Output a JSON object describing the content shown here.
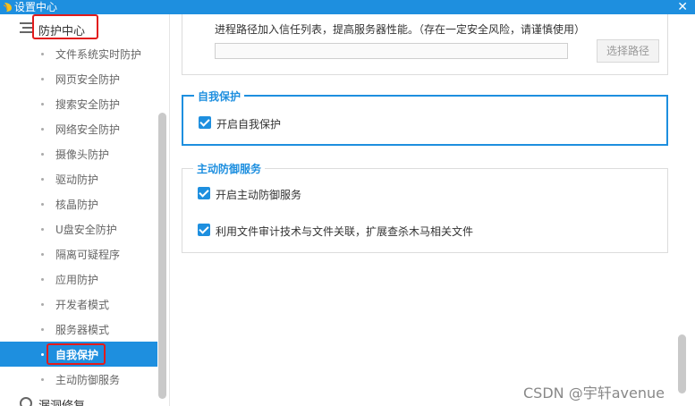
{
  "window": {
    "title": "设置中心",
    "close_symbol": "✕"
  },
  "sidebar": {
    "group_label": "防护中心",
    "items": [
      {
        "label": "文件系统实时防护"
      },
      {
        "label": "网页安全防护"
      },
      {
        "label": "搜索安全防护"
      },
      {
        "label": "网络安全防护"
      },
      {
        "label": "摄像头防护"
      },
      {
        "label": "驱动防护"
      },
      {
        "label": "核晶防护"
      },
      {
        "label": "U盘安全防护"
      },
      {
        "label": "隔离可疑程序"
      },
      {
        "label": "应用防护"
      },
      {
        "label": "开发者模式"
      },
      {
        "label": "服务器模式"
      },
      {
        "label": "自我保护"
      },
      {
        "label": "主动防御服务"
      }
    ],
    "active_index": 12,
    "bottom_group_label": "漏洞修复"
  },
  "main": {
    "trust_description": "进程路径加入信任列表，提高服务器性能。（存在一定安全风险，请谨慎使用）",
    "path_value": "",
    "select_path_button": "选择路径",
    "self_protect": {
      "title": "自我保护",
      "options": [
        {
          "label": "开启自我保护",
          "checked": true
        }
      ]
    },
    "active_defense": {
      "title": "主动防御服务",
      "options": [
        {
          "label": "开启主动防御服务",
          "checked": true
        },
        {
          "label": "利用文件审计技术与文件关联，扩展查杀木马相关文件",
          "checked": true
        }
      ]
    }
  },
  "watermark": "CSDN @宇轩avenue",
  "colors": {
    "accent": "#1e8fdf",
    "highlight_box": "#e21b1b"
  }
}
